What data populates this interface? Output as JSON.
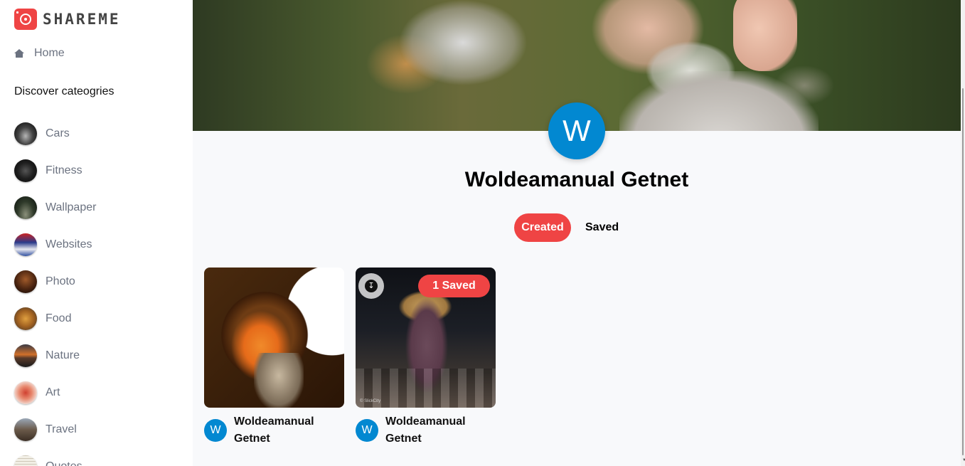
{
  "app": {
    "name": "SHAREME",
    "brand_color": "#ef4444"
  },
  "sidebar": {
    "home_label": "Home",
    "discover_heading": "Discover cateogries",
    "categories": [
      {
        "label": "Cars",
        "icon": "cars-thumbnail"
      },
      {
        "label": "Fitness",
        "icon": "fitness-thumbnail"
      },
      {
        "label": "Wallpaper",
        "icon": "wallpaper-thumbnail"
      },
      {
        "label": "Websites",
        "icon": "websites-thumbnail"
      },
      {
        "label": "Photo",
        "icon": "photo-thumbnail"
      },
      {
        "label": "Food",
        "icon": "food-thumbnail"
      },
      {
        "label": "Nature",
        "icon": "nature-thumbnail"
      },
      {
        "label": "Art",
        "icon": "art-thumbnail"
      },
      {
        "label": "Travel",
        "icon": "travel-thumbnail"
      },
      {
        "label": "Quotes",
        "icon": "quotes-thumbnail"
      }
    ]
  },
  "profile": {
    "avatar_initial": "W",
    "avatar_color": "#0288d1",
    "name": "Woldeamanual Getnet"
  },
  "tabs": {
    "created_label": "Created",
    "saved_label": "Saved",
    "active": "Created"
  },
  "pins": [
    {
      "author_initial": "W",
      "author_line1": "Woldeamanual",
      "author_line2": "Getnet"
    },
    {
      "author_initial": "W",
      "author_line1": "Woldeamanual",
      "author_line2": "Getnet",
      "saved_badge": "1 Saved",
      "credit": "© SlickCity"
    }
  ]
}
